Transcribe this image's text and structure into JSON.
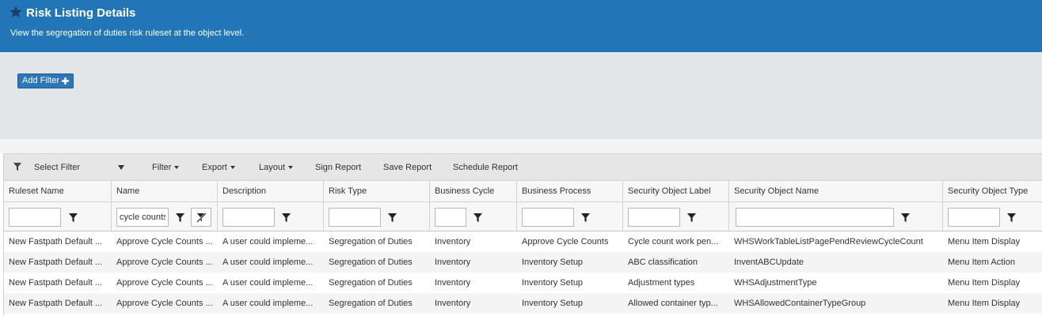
{
  "header": {
    "title": "Risk Listing Details",
    "subtitle": "View the segregation of duties risk ruleset at the object level.",
    "icon": "star-icon",
    "background": "#2276b8"
  },
  "filters": {
    "add_filter_label": "Add Filter",
    "add_filter_icon": "plus-icon"
  },
  "toolbar": {
    "select_filter": "Select Filter",
    "filter": "Filter",
    "export": "Export",
    "layout": "Layout",
    "sign_report": "Sign Report",
    "save_report": "Save Report",
    "schedule_report": "Schedule Report"
  },
  "columns": [
    "Ruleset Name",
    "Name",
    "Description",
    "Risk Type",
    "Business Cycle",
    "Business Process",
    "Security Object Label",
    "Security Object Name",
    "Security Object Type"
  ],
  "column_filters": {
    "name": "cycle counts"
  },
  "rows": [
    [
      "New Fastpath Default ...",
      "Approve Cycle Counts ...",
      "A user could impleme...",
      "Segregation of Duties",
      "Inventory",
      "Approve Cycle Counts",
      "Cycle count work pen...",
      "WHSWorkTableListPagePendReviewCycleCount",
      "Menu Item Display"
    ],
    [
      "New Fastpath Default ...",
      "Approve Cycle Counts ...",
      "A user could impleme...",
      "Segregation of Duties",
      "Inventory",
      "Inventory Setup",
      "ABC classification",
      "InventABCUpdate",
      "Menu Item Action"
    ],
    [
      "New Fastpath Default ...",
      "Approve Cycle Counts ...",
      "A user could impleme...",
      "Segregation of Duties",
      "Inventory",
      "Inventory Setup",
      "Adjustment types",
      "WHSAdjustmentType",
      "Menu Item Display"
    ],
    [
      "New Fastpath Default ...",
      "Approve Cycle Counts ...",
      "A user could impleme...",
      "Segregation of Duties",
      "Inventory",
      "Inventory Setup",
      "Allowed container typ...",
      "WHSAllowedContainerTypeGroup",
      "Menu Item Display"
    ]
  ]
}
